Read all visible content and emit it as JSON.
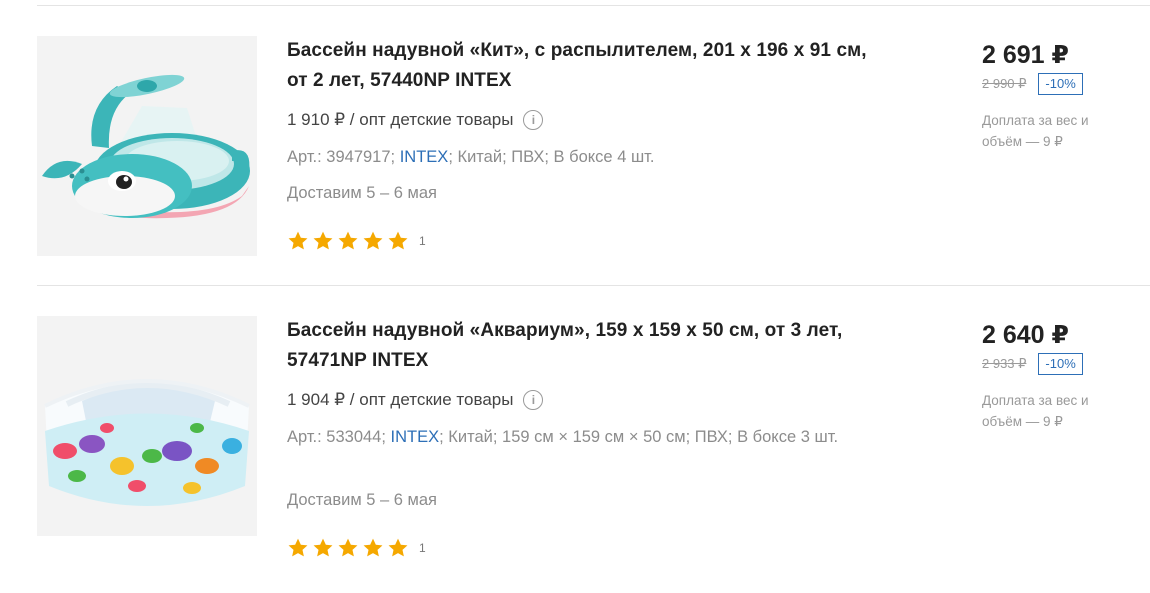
{
  "products": [
    {
      "image_subject": "inflatable whale pool",
      "title": "Бассейн надувной «Кит», с распылителем, 201 х 196 х 91 см, от 2 лет, 57440NP INTEX",
      "wholesale": "1 910 ₽ / опт детские товары",
      "meta_prefix": "Арт.: 3947917; ",
      "brand": "INTEX",
      "meta_suffix": "; Китай; ПВХ; В боксе 4 шт.",
      "delivery": "Доставим 5 – 6 мая",
      "rating_stars": 5,
      "rating_count": "1",
      "price": "2 691 ₽",
      "old_price": "2 990 ₽",
      "discount": "-10%",
      "surcharge": "Доплата за вес и объём — 9 ₽"
    },
    {
      "image_subject": "inflatable aquarium pool",
      "title": "Бассейн надувной «Аквариум», 159 х 159 х 50 см, от 3 лет, 57471NP INTEX",
      "wholesale": "1 904 ₽ / опт детские товары",
      "meta_prefix": "Арт.: 533044; ",
      "brand": "INTEX",
      "meta_suffix": "; Китай; 159 см × 159 см × 50 см; ПВХ; В боксе 3 шт.",
      "delivery": "Доставим 5 – 6 мая",
      "rating_stars": 5,
      "rating_count": "1",
      "price": "2 640 ₽",
      "old_price": "2 933 ₽",
      "discount": "-10%",
      "surcharge": "Доплата за вес и объём — 9 ₽"
    }
  ],
  "colors": {
    "star": "#f5a800",
    "brand_link": "#2d6fb7",
    "discount": "#2d6fb7"
  }
}
